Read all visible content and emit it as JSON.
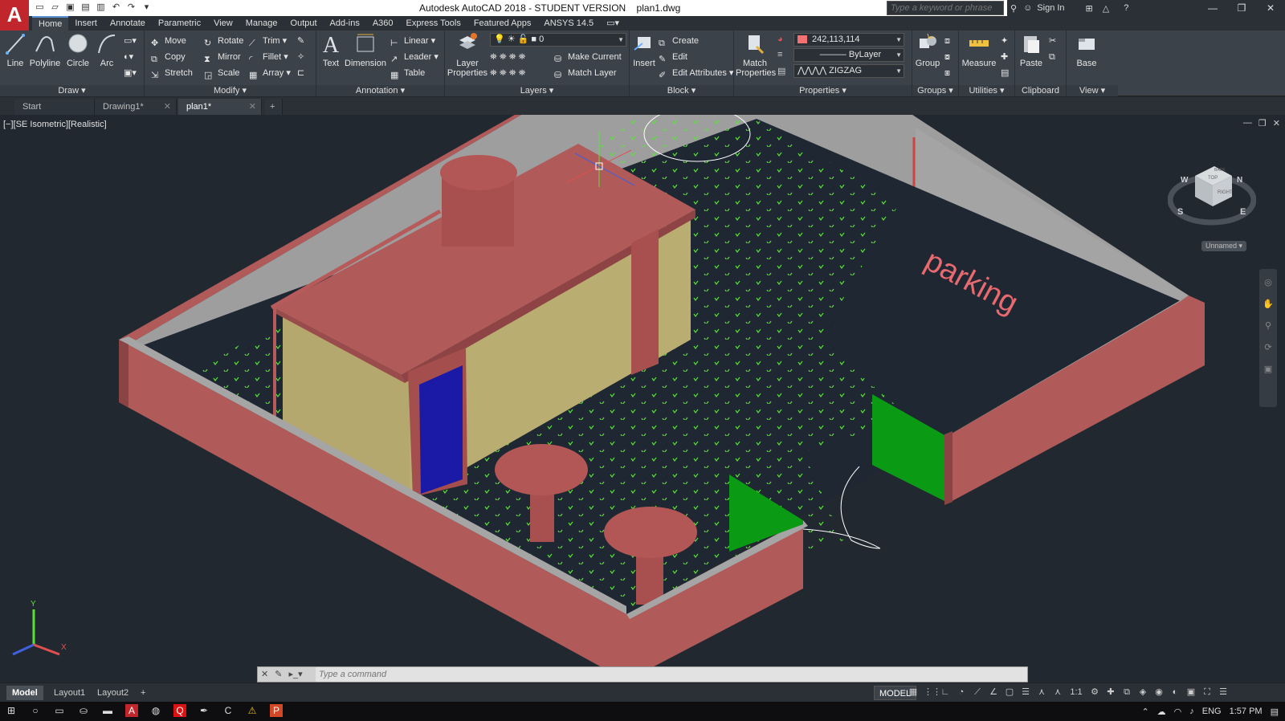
{
  "app": {
    "logo_letter": "A",
    "title": "Autodesk AutoCAD 2018 - STUDENT VERSION    plan1.dwg",
    "search_placeholder": "Type a keyword or phrase",
    "sign_in": "Sign In"
  },
  "ribbon_tabs": [
    "Home",
    "Insert",
    "Annotate",
    "Parametric",
    "View",
    "Manage",
    "Output",
    "Add-ins",
    "A360",
    "Express Tools",
    "Featured Apps",
    "ANSYS 14.5"
  ],
  "ribbon": {
    "draw": {
      "title": "Draw",
      "line": "Line",
      "polyline": "Polyline",
      "circle": "Circle",
      "arc": "Arc"
    },
    "modify": {
      "title": "Modify",
      "move": "Move",
      "rotate": "Rotate",
      "trim": "Trim",
      "copy": "Copy",
      "mirror": "Mirror",
      "fillet": "Fillet",
      "stretch": "Stretch",
      "scale": "Scale",
      "array": "Array"
    },
    "annotation": {
      "title": "Annotation",
      "text": "Text",
      "dimension": "Dimension",
      "linear": "Linear",
      "leader": "Leader",
      "table": "Table"
    },
    "layers": {
      "title": "Layers",
      "layer_properties": "Layer Properties",
      "current_layer": "0",
      "make_current": "Make Current",
      "match_layer": "Match Layer"
    },
    "block": {
      "title": "Block",
      "insert": "Insert",
      "create": "Create",
      "edit": "Edit",
      "edit_attributes": "Edit Attributes"
    },
    "properties": {
      "title": "Properties",
      "match_properties": "Match Properties",
      "color_value": "242,113,114",
      "lineweight": "ByLayer",
      "linetype": "ZIGZAG"
    },
    "groups": {
      "title": "Groups",
      "group": "Group"
    },
    "utilities": {
      "title": "Utilities",
      "measure": "Measure"
    },
    "clipboard": {
      "title": "Clipboard",
      "paste": "Paste"
    },
    "view": {
      "title": "View",
      "base": "Base"
    }
  },
  "doc_tabs": [
    {
      "label": "Start",
      "active": false
    },
    {
      "label": "Drawing1*",
      "active": false
    },
    {
      "label": "plan1*",
      "active": true
    }
  ],
  "viewport": {
    "label": "[−][SE Isometric][Realistic]",
    "scene_text": "parking",
    "viewcube_label": "Unnamed",
    "compass": {
      "south": "S",
      "east": "E",
      "north": "N",
      "west": "W"
    },
    "cube_faces": {
      "top": "TOP",
      "right": "RIGHT",
      "back": "BACK"
    },
    "ucs": {
      "x": "X",
      "y": "Y"
    }
  },
  "command_line": {
    "placeholder": "Type a command"
  },
  "layout_tabs": [
    {
      "label": "Model",
      "active": true
    },
    {
      "label": "Layout1",
      "active": false
    },
    {
      "label": "Layout2",
      "active": false
    }
  ],
  "status": {
    "model": "MODEL",
    "scale": "1:1"
  },
  "tray": {
    "language": "ENG",
    "time": "1:57 PM"
  },
  "colors": {
    "accent": "#5a94d6",
    "wall": "#b05a5a",
    "wall_top": "#9e9e9e",
    "wall_side": "#8a4444",
    "building_body": "#b5a86e",
    "door": "#1a1aa6",
    "gate": "#0a9a14",
    "grass_dot": "#5be03a",
    "parking_text": "#e96a6e",
    "background": "#212830"
  }
}
